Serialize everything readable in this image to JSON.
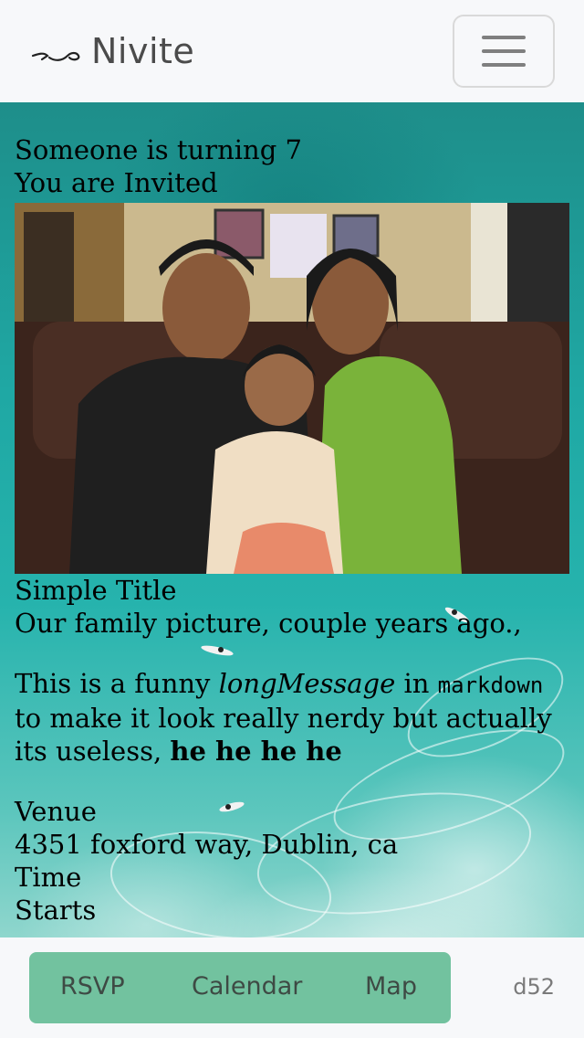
{
  "navbar": {
    "brand": "Nivite",
    "menu_icon": "hamburger-menu-icon"
  },
  "invite": {
    "line1": "Someone is turning 7",
    "line2": "You are Invited"
  },
  "photo": {
    "title": "Simple Title",
    "caption": "Our family picture, couple years ago.,"
  },
  "message": {
    "part1": "This is a funny ",
    "emphasis": "longMessage",
    "part2": " in ",
    "code": "markdown",
    "part3": " to make it look really nerdy but actually its useless, ",
    "strong": "he he he he"
  },
  "details": {
    "venue_label": "Venue",
    "venue_value": "4351 foxford way, Dublin, ca",
    "time_label": "Time",
    "starts_label": "Starts"
  },
  "actions": {
    "rsvp": "RSVP",
    "calendar": "Calendar",
    "map": "Map"
  },
  "version": "d52",
  "colors": {
    "action_bar": "#72c29f",
    "navbar_bg": "#f7f8fa",
    "ocean": "#1fa8a4"
  }
}
